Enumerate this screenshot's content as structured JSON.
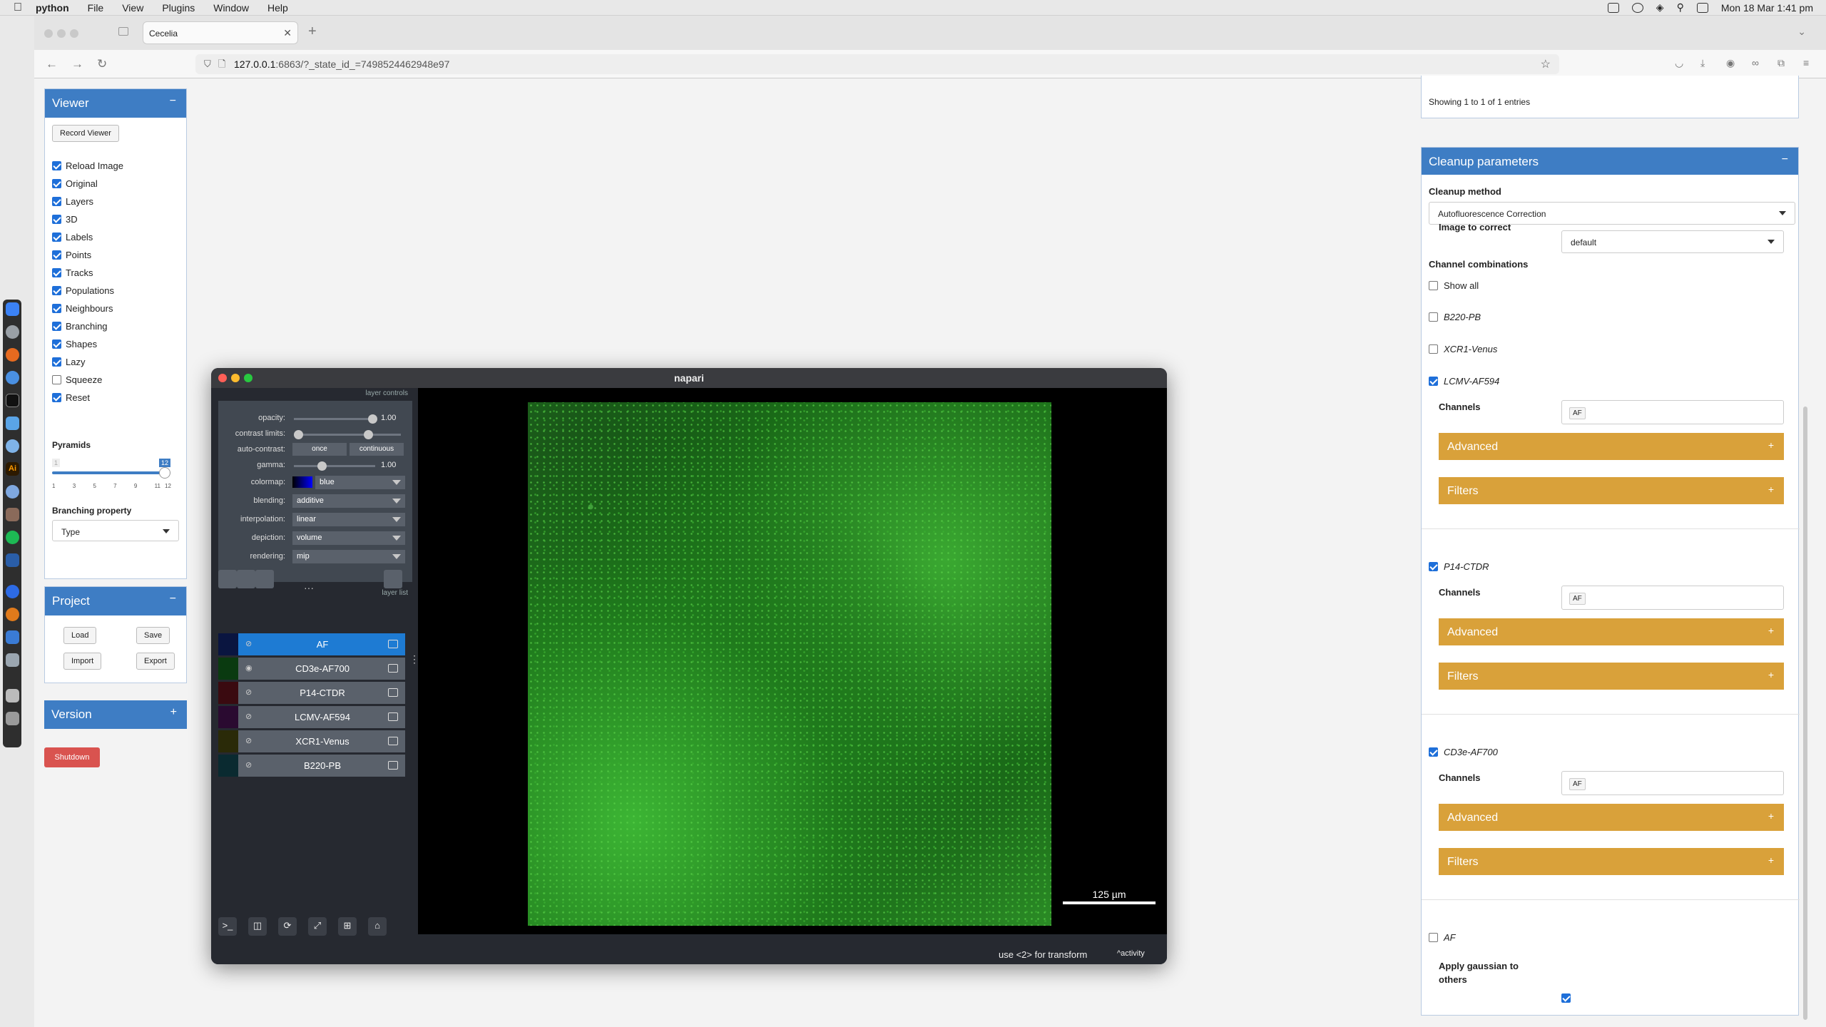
{
  "menubar": {
    "app": "python",
    "items": [
      "File",
      "View",
      "Plugins",
      "Window",
      "Help"
    ],
    "clock": "Mon 18 Mar  1:41 pm"
  },
  "browser": {
    "tab_title": "Cecelia",
    "url_host": "127.0.0.1",
    "url_rest": ":6863/?_state_id_=7498524462948e97"
  },
  "viewer": {
    "title": "Viewer",
    "record_label": "Record Viewer",
    "options": [
      {
        "label": "Reload Image",
        "checked": true
      },
      {
        "label": "Original",
        "checked": true
      },
      {
        "label": "Layers",
        "checked": true
      },
      {
        "label": "3D",
        "checked": true
      },
      {
        "label": "Labels",
        "checked": true
      },
      {
        "label": "Points",
        "checked": true
      },
      {
        "label": "Tracks",
        "checked": true
      },
      {
        "label": "Populations",
        "checked": true
      },
      {
        "label": "Neighbours",
        "checked": true
      },
      {
        "label": "Branching",
        "checked": true
      },
      {
        "label": "Shapes",
        "checked": true
      },
      {
        "label": "Lazy",
        "checked": true
      },
      {
        "label": "Squeeze",
        "checked": false
      },
      {
        "label": "Reset",
        "checked": true
      }
    ],
    "pyramids_label": "Pyramids",
    "pyramids_min": "1",
    "pyramids_value": "12",
    "pyramids_ticks": [
      "1",
      "3",
      "5",
      "7",
      "9",
      "11",
      "12"
    ],
    "pyramids_level": 1.0,
    "branching_label": "Branching property",
    "branching_value": "Type"
  },
  "project": {
    "title": "Project",
    "load": "Load",
    "save": "Save",
    "import": "Import",
    "export": "Export"
  },
  "version": {
    "title": "Version"
  },
  "shutdown": "Shutdown",
  "napari": {
    "title": "napari",
    "layer_controls": "layer controls",
    "layer_list": "layer list",
    "opacity_label": "opacity:",
    "opacity_value": "1.00",
    "opacity_level": 1.0,
    "contrast_label": "contrast limits:",
    "autocontrast_label": "auto-contrast:",
    "once": "once",
    "continuous": "continuous",
    "gamma_label": "gamma:",
    "gamma_value": "1.00",
    "gamma_level": 0.5,
    "colormap_label": "colormap:",
    "colormap_value": "blue",
    "blending_label": "blending:",
    "blending_value": "additive",
    "interpolation_label": "interpolation:",
    "interpolation_value": "linear",
    "depiction_label": "depiction:",
    "depiction_value": "volume",
    "rendering_label": "rendering:",
    "rendering_value": "mip",
    "layers": [
      {
        "name": "AF",
        "selected": true,
        "visible": false
      },
      {
        "name": "CD3e-AF700",
        "selected": false,
        "visible": true
      },
      {
        "name": "P14-CTDR",
        "selected": false,
        "visible": false
      },
      {
        "name": "LCMV-AF594",
        "selected": false,
        "visible": false
      },
      {
        "name": "XCR1-Venus",
        "selected": false,
        "visible": false
      },
      {
        "name": "B220-PB",
        "selected": false,
        "visible": false
      }
    ],
    "scalebar": "125 µm",
    "status": "use <2> for transform",
    "activity": "activity"
  },
  "table": {
    "showing": "Showing 1 to 1 of 1 entries"
  },
  "cleanup": {
    "title": "Cleanup parameters",
    "method_label": "Cleanup method",
    "method_value": "Autofluorescence Correction",
    "image_label": "Image to correct",
    "image_value": "default",
    "combos_label": "Channel combinations",
    "show_all": "Show all",
    "b220": "B220-PB",
    "xcr1": "XCR1-Venus",
    "lcmv": "LCMV-AF594",
    "p14": "P14-CTDR",
    "cd3e": "CD3e-AF700",
    "af": "AF",
    "channels_label": "Channels",
    "af_tag": "AF",
    "advanced": "Advanced",
    "filters": "Filters",
    "gaussian_label_1": "Apply gaussian to",
    "gaussian_label_2": "others"
  }
}
